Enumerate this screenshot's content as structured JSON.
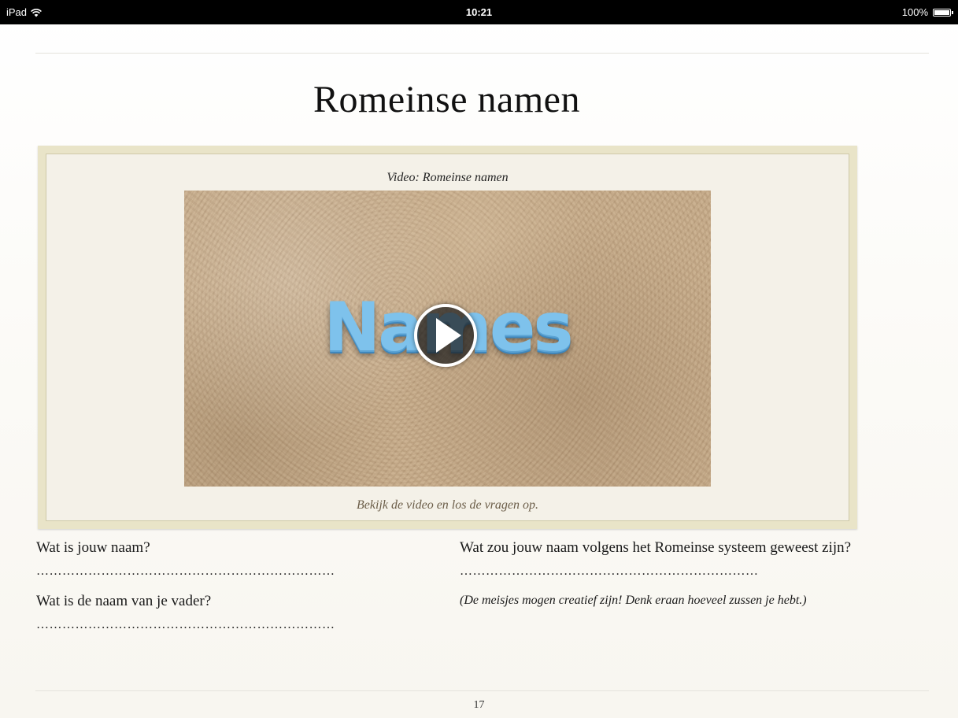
{
  "status_bar": {
    "device": "iPad",
    "time": "10:21",
    "battery": "100%",
    "battery_level": 1.0
  },
  "page": {
    "title": "Romeinse namen",
    "number": "17"
  },
  "widget": {
    "caption": "Video: Romeinse namen",
    "poster_text": "Names",
    "instruction": "Bekijk de video en los de vragen op.",
    "play_icon": "play-icon"
  },
  "questions": {
    "left": [
      {
        "label": "Wat is jouw naam?",
        "answer": "……………………………………………………………"
      },
      {
        "label": "Wat is de naam van je vader?",
        "answer": "……………………………………………………………"
      }
    ],
    "right": {
      "label": "Wat zou jouw naam volgens het Romeinse systeem geweest zijn?",
      "answer": "……………………………………………………………",
      "note": "(De meisjes mogen creatief zijn! Denk eraan hoeveel zussen je hebt.)"
    }
  }
}
